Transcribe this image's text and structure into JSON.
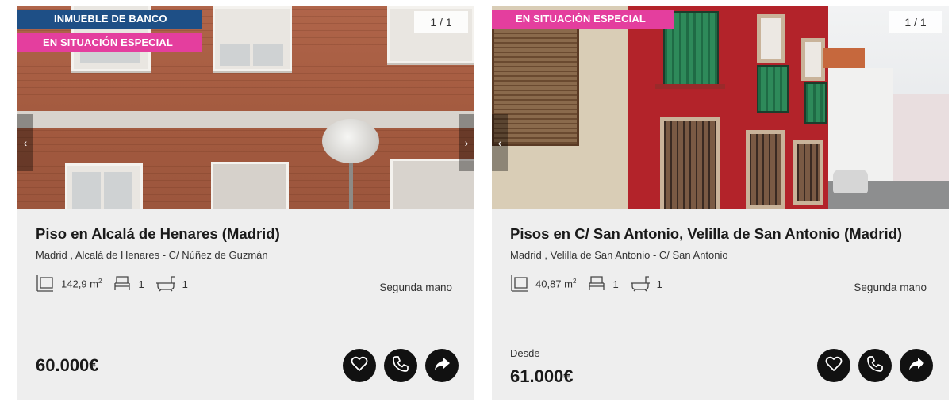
{
  "listings": [
    {
      "badges": [
        "INMUEBLE DE BANCO",
        "EN SITUACIÓN ESPECIAL"
      ],
      "photo_counter": "1 / 1",
      "title": "Piso en Alcalá de Henares (Madrid)",
      "address": "Madrid , Alcalá de Henares - C/ Núñez de Guzmán",
      "features": {
        "area": "142,9 m",
        "area_unit_sup": "2",
        "bedrooms": "1",
        "bathrooms": "1"
      },
      "condition": "Segunda mano",
      "price_prefix": "",
      "price": "60.000€"
    },
    {
      "badges": [
        "EN SITUACIÓN ESPECIAL"
      ],
      "photo_counter": "1 / 1",
      "title": "Pisos en C/ San Antonio, Velilla de San Antonio (Madrid)",
      "address": "Madrid , Velilla de San Antonio - C/ San Antonio",
      "features": {
        "area": "40,87 m",
        "area_unit_sup": "2",
        "bedrooms": "1",
        "bathrooms": "1"
      },
      "condition": "Segunda mano",
      "price_prefix": "Desde",
      "price": "61.000€"
    }
  ],
  "icons": {
    "area": "area-icon",
    "bedrooms": "bed-icon",
    "bathrooms": "bathtub-icon",
    "favorite": "heart-icon",
    "call": "phone-icon",
    "share": "share-icon"
  },
  "colors": {
    "bank_badge": "#1e4f86",
    "special_badge": "#e43e9e",
    "card_background": "#eeeeee",
    "action_button": "#111111"
  }
}
